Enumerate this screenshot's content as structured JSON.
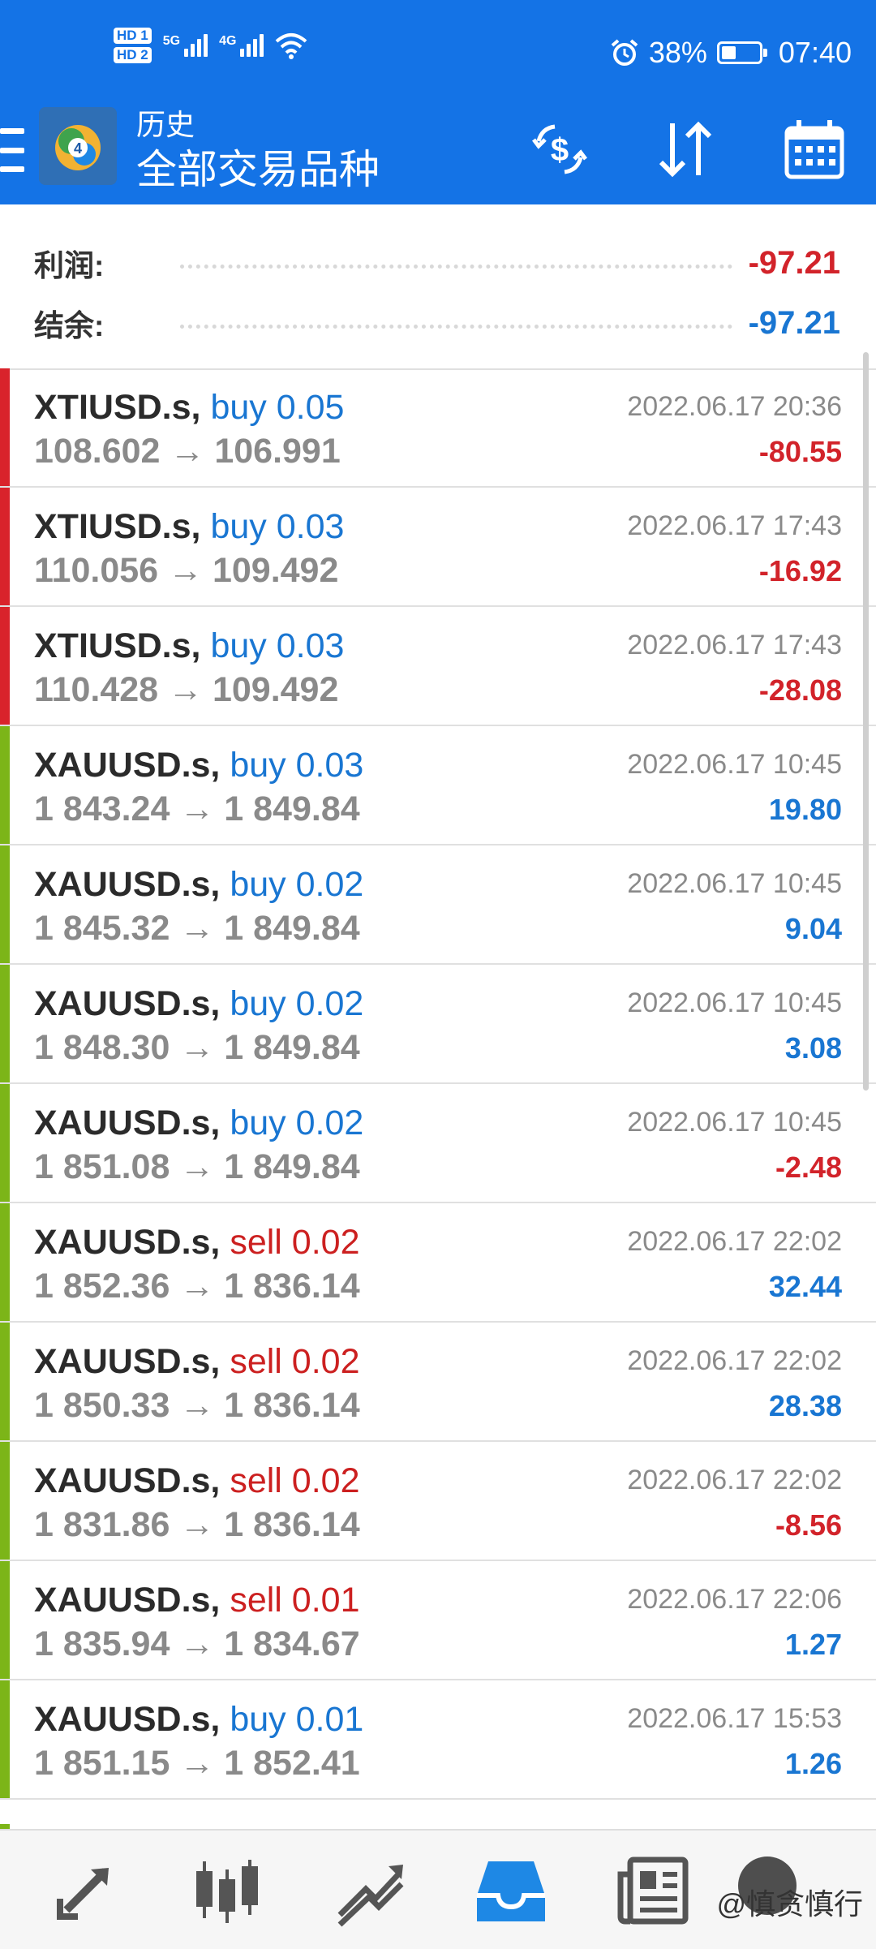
{
  "status_bar": {
    "hd1": "HD 1",
    "hd2": "HD 2",
    "net1": "5G",
    "net2": "4G",
    "battery_pct": "38%",
    "battery_level": 0.38,
    "time": "07:40"
  },
  "header": {
    "subtitle": "历史",
    "title": "全部交易品种",
    "icons": [
      "menu-icon",
      "app-logo",
      "currency-exchange-icon",
      "sort-icon",
      "calendar-icon"
    ]
  },
  "summary": {
    "profit_label": "利润:",
    "profit_value": "-97.21",
    "balance_label": "结余:",
    "balance_value": "-97.21"
  },
  "trades": [
    {
      "symbol": "XTIUSD.s,",
      "side": "buy 0.05",
      "prices": "108.602 → 106.991",
      "time": "2022.06.17 20:36",
      "profit": "-80.55"
    },
    {
      "symbol": "XTIUSD.s,",
      "side": "buy 0.03",
      "prices": "110.056 → 109.492",
      "time": "2022.06.17 17:43",
      "profit": "-16.92"
    },
    {
      "symbol": "XTIUSD.s,",
      "side": "buy 0.03",
      "prices": "110.428 → 109.492",
      "time": "2022.06.17 17:43",
      "profit": "-28.08"
    },
    {
      "symbol": "XAUUSD.s,",
      "side": "buy 0.03",
      "prices": "1 843.24 → 1 849.84",
      "time": "2022.06.17 10:45",
      "profit": "19.80"
    },
    {
      "symbol": "XAUUSD.s,",
      "side": "buy 0.02",
      "prices": "1 845.32 → 1 849.84",
      "time": "2022.06.17 10:45",
      "profit": "9.04"
    },
    {
      "symbol": "XAUUSD.s,",
      "side": "buy 0.02",
      "prices": "1 848.30 → 1 849.84",
      "time": "2022.06.17 10:45",
      "profit": "3.08"
    },
    {
      "symbol": "XAUUSD.s,",
      "side": "buy 0.02",
      "prices": "1 851.08 → 1 849.84",
      "time": "2022.06.17 10:45",
      "profit": "-2.48"
    },
    {
      "symbol": "XAUUSD.s,",
      "side": "sell 0.02",
      "prices": "1 852.36 → 1 836.14",
      "time": "2022.06.17 22:02",
      "profit": "32.44"
    },
    {
      "symbol": "XAUUSD.s,",
      "side": "sell 0.02",
      "prices": "1 850.33 → 1 836.14",
      "time": "2022.06.17 22:02",
      "profit": "28.38"
    },
    {
      "symbol": "XAUUSD.s,",
      "side": "sell 0.02",
      "prices": "1 831.86 → 1 836.14",
      "time": "2022.06.17 22:02",
      "profit": "-8.56"
    },
    {
      "symbol": "XAUUSD.s,",
      "side": "sell 0.01",
      "prices": "1 835.94 → 1 834.67",
      "time": "2022.06.17 22:06",
      "profit": "1.27"
    },
    {
      "symbol": "XAUUSD.s,",
      "side": "buy 0.01",
      "prices": "1 851.15 → 1 852.41",
      "time": "2022.06.17 15:53",
      "profit": "1.26"
    }
  ],
  "bottom_nav": {
    "items": [
      "quotes-icon",
      "chart-icon",
      "trade-icon",
      "history-icon",
      "news-icon"
    ],
    "active": "history-icon"
  },
  "watermark": "@慎贪慎行",
  "colors": {
    "header": "#1473e6",
    "loss": "#d2232a",
    "gain": "#1976d2",
    "buy": "#1976d2",
    "sell": "#cc2020",
    "oil_accent": "#d9232b",
    "gold_accent": "#7cb518"
  }
}
